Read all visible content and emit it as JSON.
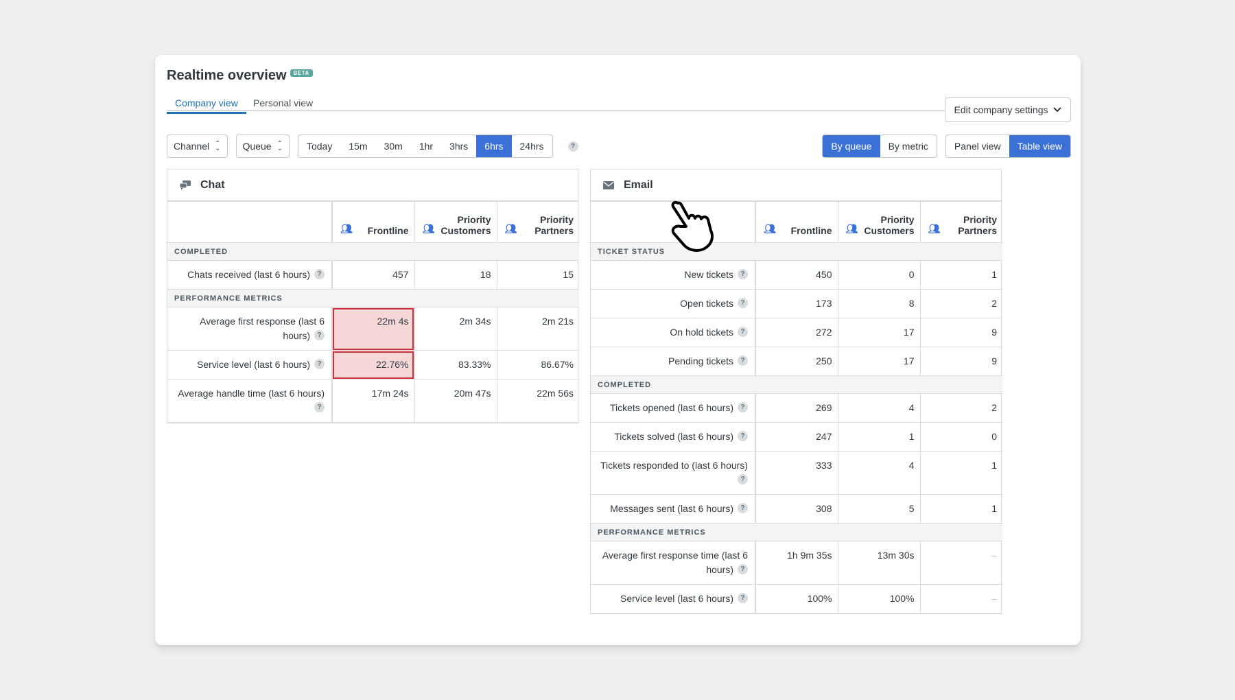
{
  "header": {
    "title": "Realtime overview",
    "badge": "BETA"
  },
  "tabs": {
    "company": "Company view",
    "personal": "Personal view"
  },
  "settings_button": "Edit company settings",
  "filters": {
    "channel": "Channel",
    "queue": "Queue",
    "time_ranges": [
      "Today",
      "15m",
      "30m",
      "1hr",
      "3hrs",
      "6hrs",
      "24hrs"
    ],
    "active_range": "6hrs",
    "help": "?"
  },
  "group_toggle": {
    "by_queue": "By queue",
    "by_metric": "By metric",
    "active": "By queue"
  },
  "view_toggle": {
    "panel": "Panel view",
    "table": "Table view",
    "active": "Table view"
  },
  "columns": {
    "frontline": "Frontline",
    "priority_customers_1": "Priority",
    "priority_customers_2": "Customers",
    "priority_partners_1": "Priority",
    "priority_partners_2": "Partners"
  },
  "chat": {
    "title": "Chat",
    "sections": {
      "completed": "COMPLETED",
      "performance": "PERFORMANCE METRICS"
    },
    "rows": [
      {
        "label": "Chats received (last 6 hours)",
        "values": [
          "457",
          "18",
          "15"
        ]
      },
      {
        "label": "Average first response (last 6 hours)",
        "values": [
          "22m 4s",
          "2m 34s",
          "2m 21s"
        ]
      },
      {
        "label": "Service level (last 6 hours)",
        "values": [
          "22.76%",
          "83.33%",
          "86.67%"
        ]
      },
      {
        "label": "Average handle time (last 6 hours)",
        "values": [
          "17m 24s",
          "20m 47s",
          "22m 56s"
        ]
      }
    ]
  },
  "email": {
    "title": "Email",
    "sections": {
      "ticket_status": "TICKET STATUS",
      "completed": "COMPLETED",
      "performance": "PERFORMANCE METRICS"
    },
    "rows": [
      {
        "label": "New tickets",
        "values": [
          "450",
          "0",
          "1"
        ]
      },
      {
        "label": "Open tickets",
        "values": [
          "173",
          "8",
          "2"
        ]
      },
      {
        "label": "On hold tickets",
        "values": [
          "272",
          "17",
          "9"
        ]
      },
      {
        "label": "Pending tickets",
        "values": [
          "250",
          "17",
          "9"
        ]
      },
      {
        "label": "Tickets opened (last 6 hours)",
        "values": [
          "269",
          "4",
          "2"
        ]
      },
      {
        "label": "Tickets solved (last 6 hours)",
        "values": [
          "247",
          "1",
          "0"
        ]
      },
      {
        "label": "Tickets responded to (last 6 hours)",
        "values": [
          "333",
          "4",
          "1"
        ]
      },
      {
        "label": "Messages sent (last 6 hours)",
        "values": [
          "308",
          "5",
          "1"
        ]
      },
      {
        "label": "Average first response time (last 6 hours)",
        "values": [
          "1h 9m 35s",
          "13m 30s",
          "–"
        ]
      },
      {
        "label": "Service level (last 6 hours)",
        "values": [
          "100%",
          "100%",
          "–"
        ]
      }
    ]
  },
  "colors": {
    "accent": "#3b70d6",
    "highlight_fill": "#f6d7d8",
    "highlight_border": "#cc3340",
    "badge": "#5aa5a0"
  },
  "icons": {
    "chat": "chat-bubbles-icon",
    "email": "envelope-icon",
    "queue": "people-icon",
    "cursor": "hand-pointer-icon"
  }
}
